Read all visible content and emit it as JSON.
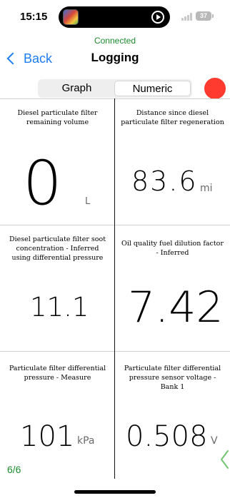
{
  "status_bar": {
    "time": "15:15",
    "battery": "37"
  },
  "connection_status": "Connected",
  "nav": {
    "back_label": "Back",
    "title": "Logging"
  },
  "view_toggle": {
    "options": [
      "Graph",
      "Numeric"
    ],
    "selected": "Numeric"
  },
  "colors": {
    "accent": "#1e7cf2",
    "connected": "#1e8a2e",
    "record": "#ff3b30"
  },
  "readings": [
    {
      "label": "Diesel particulate filter remaining volume",
      "value": "0",
      "unit": "L"
    },
    {
      "label": "Distance since diesel particulate filter regeneration",
      "value": "83.6",
      "unit": "mi"
    },
    {
      "label": "Diesel particulate filter soot concentration  -  Inferred using differential pressure",
      "value": "11.1",
      "unit": ""
    },
    {
      "label": "Oil quality fuel dilution factor  -  Inferred",
      "value": "7.42",
      "unit": ""
    },
    {
      "label": "Particulate filter differential pressure  -  Measure",
      "value": "101",
      "unit": "kPa"
    },
    {
      "label": "Particulate filter differential pressure sensor voltage  -  Bank 1",
      "value": "0.508",
      "unit": "V"
    }
  ],
  "page_indicator": "6/6",
  "icons": {
    "back": "chevron-left-icon",
    "next": "chevron-left-icon",
    "record": "record-icon"
  }
}
